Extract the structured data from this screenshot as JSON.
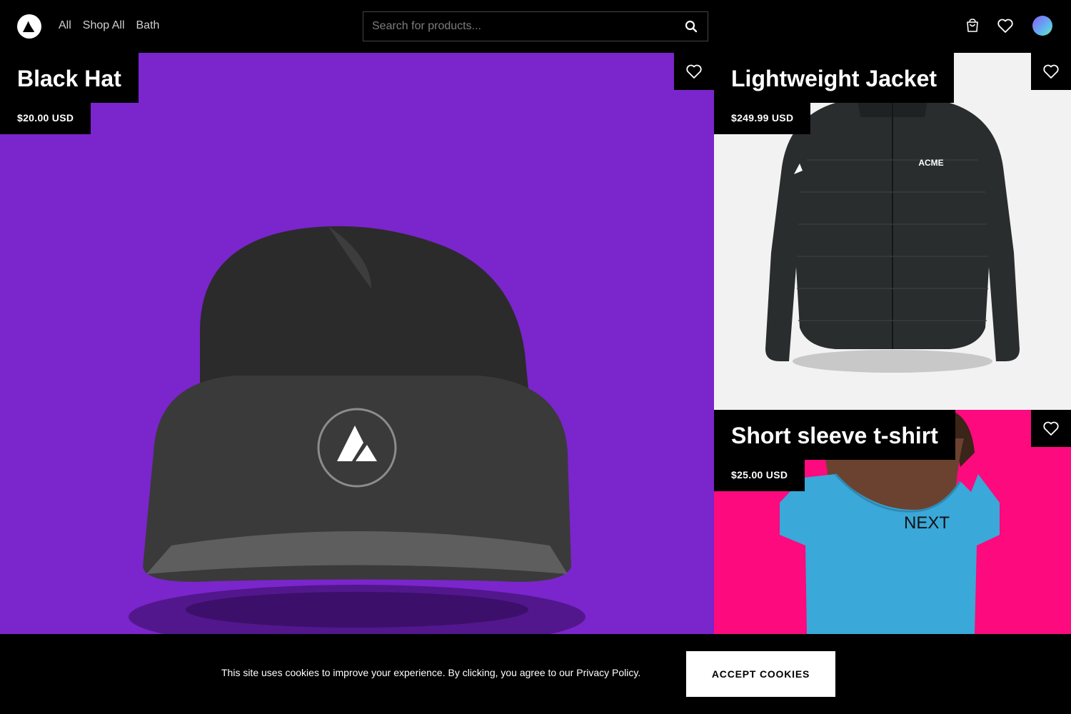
{
  "nav": {
    "links": [
      "All",
      "Shop All",
      "Bath"
    ],
    "search_placeholder": "Search for products...",
    "icons": [
      "logo-icon",
      "search-icon",
      "cart-icon",
      "heart-icon",
      "avatar"
    ]
  },
  "products": [
    {
      "title": "Black Hat",
      "price": "$20.00 USD",
      "bg_color": "#7b25cc",
      "image_logo_text": ""
    },
    {
      "title": "Lightweight Jacket",
      "price": "$249.99 USD",
      "bg_color": "#f2f2f2",
      "image_logo_text": "ACME"
    },
    {
      "title": "Short sleeve t-shirt",
      "price": "$25.00 USD",
      "bg_color": "#fc0a7e",
      "image_logo_text": "NEXT"
    }
  ],
  "cookie": {
    "text": "This site uses cookies to improve your experience. By clicking, you agree to our Privacy Policy.",
    "button_label": "ACCEPT COOKIES"
  },
  "colors": {
    "background": "#000000",
    "hat_bg": "#7b25cc",
    "tshirt_bg": "#fc0a7e",
    "tshirt": "#3aa8d8"
  }
}
